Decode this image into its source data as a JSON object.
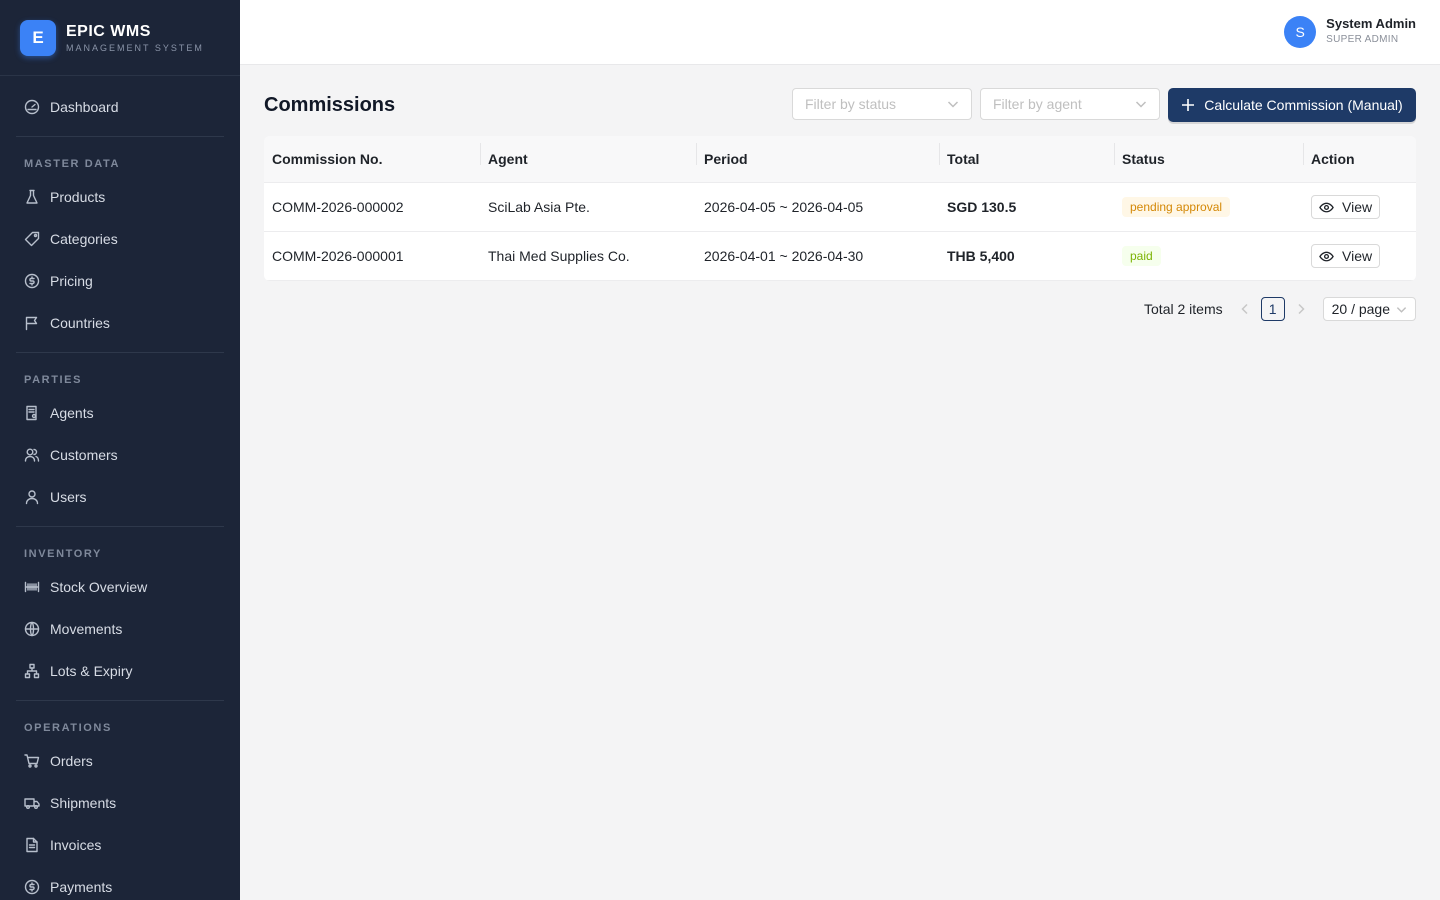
{
  "brand": {
    "logo_letter": "E",
    "title": "EPIC WMS",
    "subtitle": "MANAGEMENT SYSTEM",
    "accent": "#3b82f6"
  },
  "sidebar": {
    "dashboard": "Dashboard",
    "sections": {
      "master_data": {
        "title": "MASTER DATA",
        "items": [
          "Products",
          "Categories",
          "Pricing",
          "Countries"
        ]
      },
      "parties": {
        "title": "PARTIES",
        "items": [
          "Agents",
          "Customers",
          "Users"
        ]
      },
      "inventory": {
        "title": "INVENTORY",
        "items": [
          "Stock Overview",
          "Movements",
          "Lots & Expiry"
        ]
      },
      "operations": {
        "title": "OPERATIONS",
        "items": [
          "Orders",
          "Shipments",
          "Invoices",
          "Payments"
        ]
      }
    }
  },
  "header": {
    "avatar_letter": "S",
    "user_name": "System Admin",
    "user_role": "SUPER ADMIN"
  },
  "page": {
    "title": "Commissions",
    "filter_status_placeholder": "Filter by status",
    "filter_agent_placeholder": "Filter by agent",
    "calc_button": "Calculate Commission (Manual)"
  },
  "table": {
    "columns": [
      "Commission No.",
      "Agent",
      "Period",
      "Total",
      "Status",
      "Action"
    ],
    "rows": [
      {
        "no": "COMM-2026-000002",
        "agent": "SciLab Asia Pte.",
        "period": "2026-04-05 ~ 2026-04-05",
        "total": "SGD 130.5",
        "status": "pending approval",
        "action": "View"
      },
      {
        "no": "COMM-2026-000001",
        "agent": "Thai Med Supplies Co.",
        "period": "2026-04-01 ~ 2026-04-30",
        "total": "THB 5,400",
        "status": "paid",
        "action": "View"
      }
    ]
  },
  "pagination": {
    "total_text": "Total 2 items",
    "current_page": "1",
    "page_size": "20 / page"
  },
  "colors": {
    "sidebar_bg": "#1c2538",
    "primary": "#1e3a67",
    "pending": "#d48806",
    "paid": "#7cb305"
  }
}
